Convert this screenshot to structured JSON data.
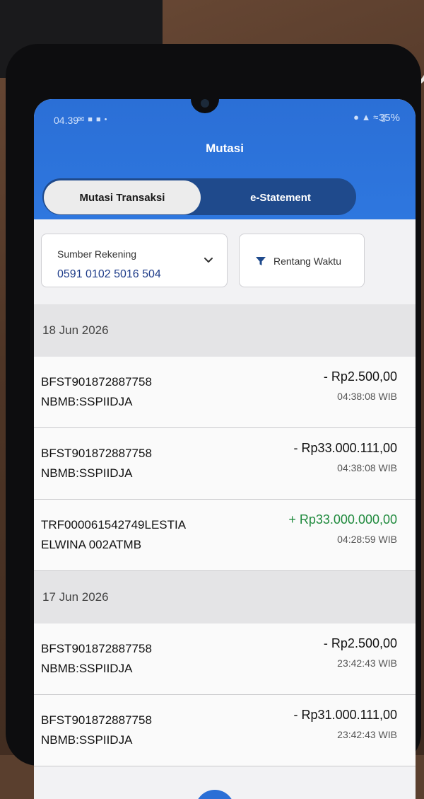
{
  "status_bar": {
    "time": "04.39",
    "battery": "35%"
  },
  "header": {
    "title": "Mutasi",
    "tabs": [
      {
        "label": "Mutasi Transaksi",
        "active": true
      },
      {
        "label": "e-Statement",
        "active": false
      }
    ]
  },
  "filters": {
    "source_label": "Sumber Rekening",
    "source_value": "0591 0102 5016 504",
    "range_label": "Rentang Waktu"
  },
  "groups": [
    {
      "date": "18 Jun 2026",
      "transactions": [
        {
          "desc1": "BFST901872887758",
          "desc2": "NBMB:SSPIIDJA",
          "amount": "- Rp2.500,00",
          "time": "04:38:08 WIB",
          "type": "debit"
        },
        {
          "desc1": "BFST901872887758",
          "desc2": "NBMB:SSPIIDJA",
          "amount": "- Rp33.000.111,00",
          "time": "04:38:08 WIB",
          "type": "debit"
        },
        {
          "desc1": "TRF000061542749LESTIA",
          "desc2": "ELWINA 002ATMB",
          "amount": "+ Rp33.000.000,00",
          "time": "04:28:59 WIB",
          "type": "credit"
        }
      ]
    },
    {
      "date": "17 Jun 2026",
      "transactions": [
        {
          "desc1": "BFST901872887758",
          "desc2": "NBMB:SSPIIDJA",
          "amount": "- Rp2.500,00",
          "time": "23:42:43 WIB",
          "type": "debit"
        },
        {
          "desc1": "BFST901872887758",
          "desc2": "NBMB:SSPIIDJA",
          "amount": "- Rp31.000.111,00",
          "time": "23:42:43 WIB",
          "type": "debit"
        }
      ]
    }
  ],
  "colors": {
    "header_blue": "#2b6fd6",
    "credit_green": "#1f8a3d"
  }
}
